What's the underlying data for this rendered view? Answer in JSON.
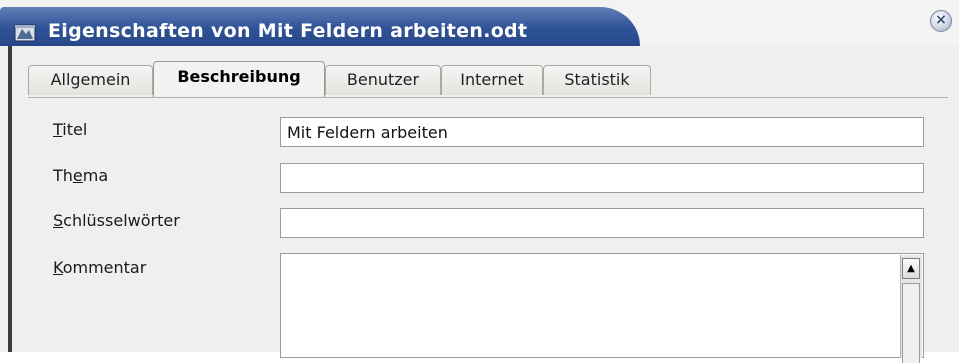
{
  "window": {
    "title": "Eigenschaften von Mit Feldern arbeiten.odt",
    "close_symbol": "×"
  },
  "tabs": [
    {
      "label": "Allgemein",
      "active": false
    },
    {
      "label": "Beschreibung",
      "active": true
    },
    {
      "label": "Benutzer",
      "active": false
    },
    {
      "label": "Internet",
      "active": false
    },
    {
      "label": "Statistik",
      "active": false
    }
  ],
  "form": {
    "titel": {
      "label_mnemonic": "T",
      "label_rest": "itel",
      "value": "Mit Feldern arbeiten"
    },
    "thema": {
      "label_pre": "Th",
      "label_mnemonic": "e",
      "label_post": "ma",
      "value": ""
    },
    "schluesselwoerter": {
      "label_mnemonic": "S",
      "label_rest": "chlüsselwörter",
      "value": ""
    },
    "kommentar": {
      "label_mnemonic": "K",
      "label_rest": "ommentar",
      "value": ""
    }
  },
  "icons": {
    "app": "document-icon",
    "close": "close-icon",
    "scroll_up": "arrow-up-icon"
  },
  "scroll_up_glyph": "▲",
  "colors": {
    "titlebar": "#2f5297",
    "dialog_bg": "#efefee"
  }
}
